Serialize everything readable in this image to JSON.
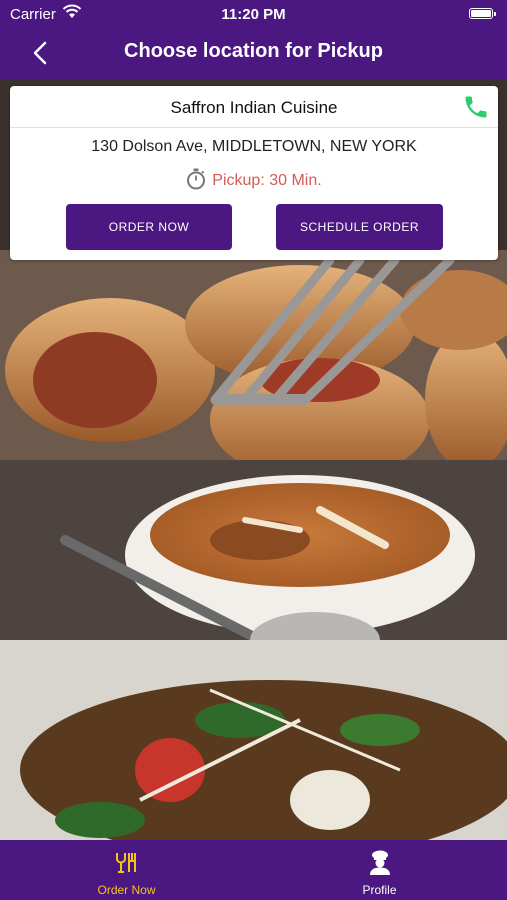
{
  "status_bar": {
    "carrier": "Carrier",
    "time": "11:20 PM"
  },
  "nav": {
    "title": "Choose location for Pickup"
  },
  "location": {
    "name": "Saffron Indian Cuisine",
    "address": "130 Dolson Ave, MIDDLETOWN, NEW YORK",
    "pickup": "Pickup: 30 Min.",
    "order_now_label": "ORDER NOW",
    "schedule_label": "SCHEDULE ORDER"
  },
  "tabs": [
    {
      "label": "Order Now",
      "icon": "dining-icon",
      "active": true
    },
    {
      "label": "Profile",
      "icon": "chef-icon",
      "active": false
    }
  ],
  "colors": {
    "brand": "#4b1780",
    "active_tab": "#f5c518",
    "pickup_text": "#d45a55",
    "phone_icon": "#2ecc71"
  }
}
